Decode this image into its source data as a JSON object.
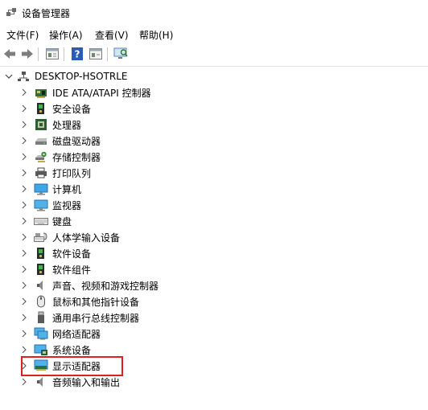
{
  "window": {
    "title": "设备管理器",
    "icon": "device-manager-icon"
  },
  "menu": {
    "items": [
      "文件(F)",
      "操作(A)",
      "查看(V)",
      "帮助(H)"
    ]
  },
  "toolbar": {
    "buttons": [
      "back-icon",
      "forward-icon",
      "properties-icon",
      "help-icon",
      "update-driver-icon",
      "scan-hardware-icon"
    ]
  },
  "tree": {
    "root": {
      "label": "DESKTOP-HSOTRLE",
      "expanded": true,
      "icon": "computer-network-icon"
    },
    "items": [
      {
        "label": "IDE ATA/ATAPI 控制器",
        "icon": "ide-controller-icon"
      },
      {
        "label": "安全设备",
        "icon": "security-device-icon"
      },
      {
        "label": "处理器",
        "icon": "processor-icon"
      },
      {
        "label": "磁盘驱动器",
        "icon": "disk-drive-icon"
      },
      {
        "label": "存储控制器",
        "icon": "storage-controller-icon"
      },
      {
        "label": "打印队列",
        "icon": "printer-icon"
      },
      {
        "label": "计算机",
        "icon": "computer-icon"
      },
      {
        "label": "监视器",
        "icon": "monitor-icon"
      },
      {
        "label": "键盘",
        "icon": "keyboard-icon"
      },
      {
        "label": "人体学输入设备",
        "icon": "hid-icon"
      },
      {
        "label": "软件设备",
        "icon": "software-device-icon"
      },
      {
        "label": "软件组件",
        "icon": "software-component-icon"
      },
      {
        "label": "声音、视频和游戏控制器",
        "icon": "speaker-icon"
      },
      {
        "label": "鼠标和其他指针设备",
        "icon": "mouse-icon"
      },
      {
        "label": "通用串行总线控制器",
        "icon": "usb-icon"
      },
      {
        "label": "网络适配器",
        "icon": "network-adapter-icon"
      },
      {
        "label": "系统设备",
        "icon": "system-device-icon"
      },
      {
        "label": "显示适配器",
        "icon": "display-adapter-icon",
        "highlighted": true
      },
      {
        "label": "音频输入和输出",
        "icon": "audio-io-icon"
      }
    ]
  },
  "colors": {
    "highlight_border": "#e02020",
    "accent_blue": "#1e7fd8"
  }
}
